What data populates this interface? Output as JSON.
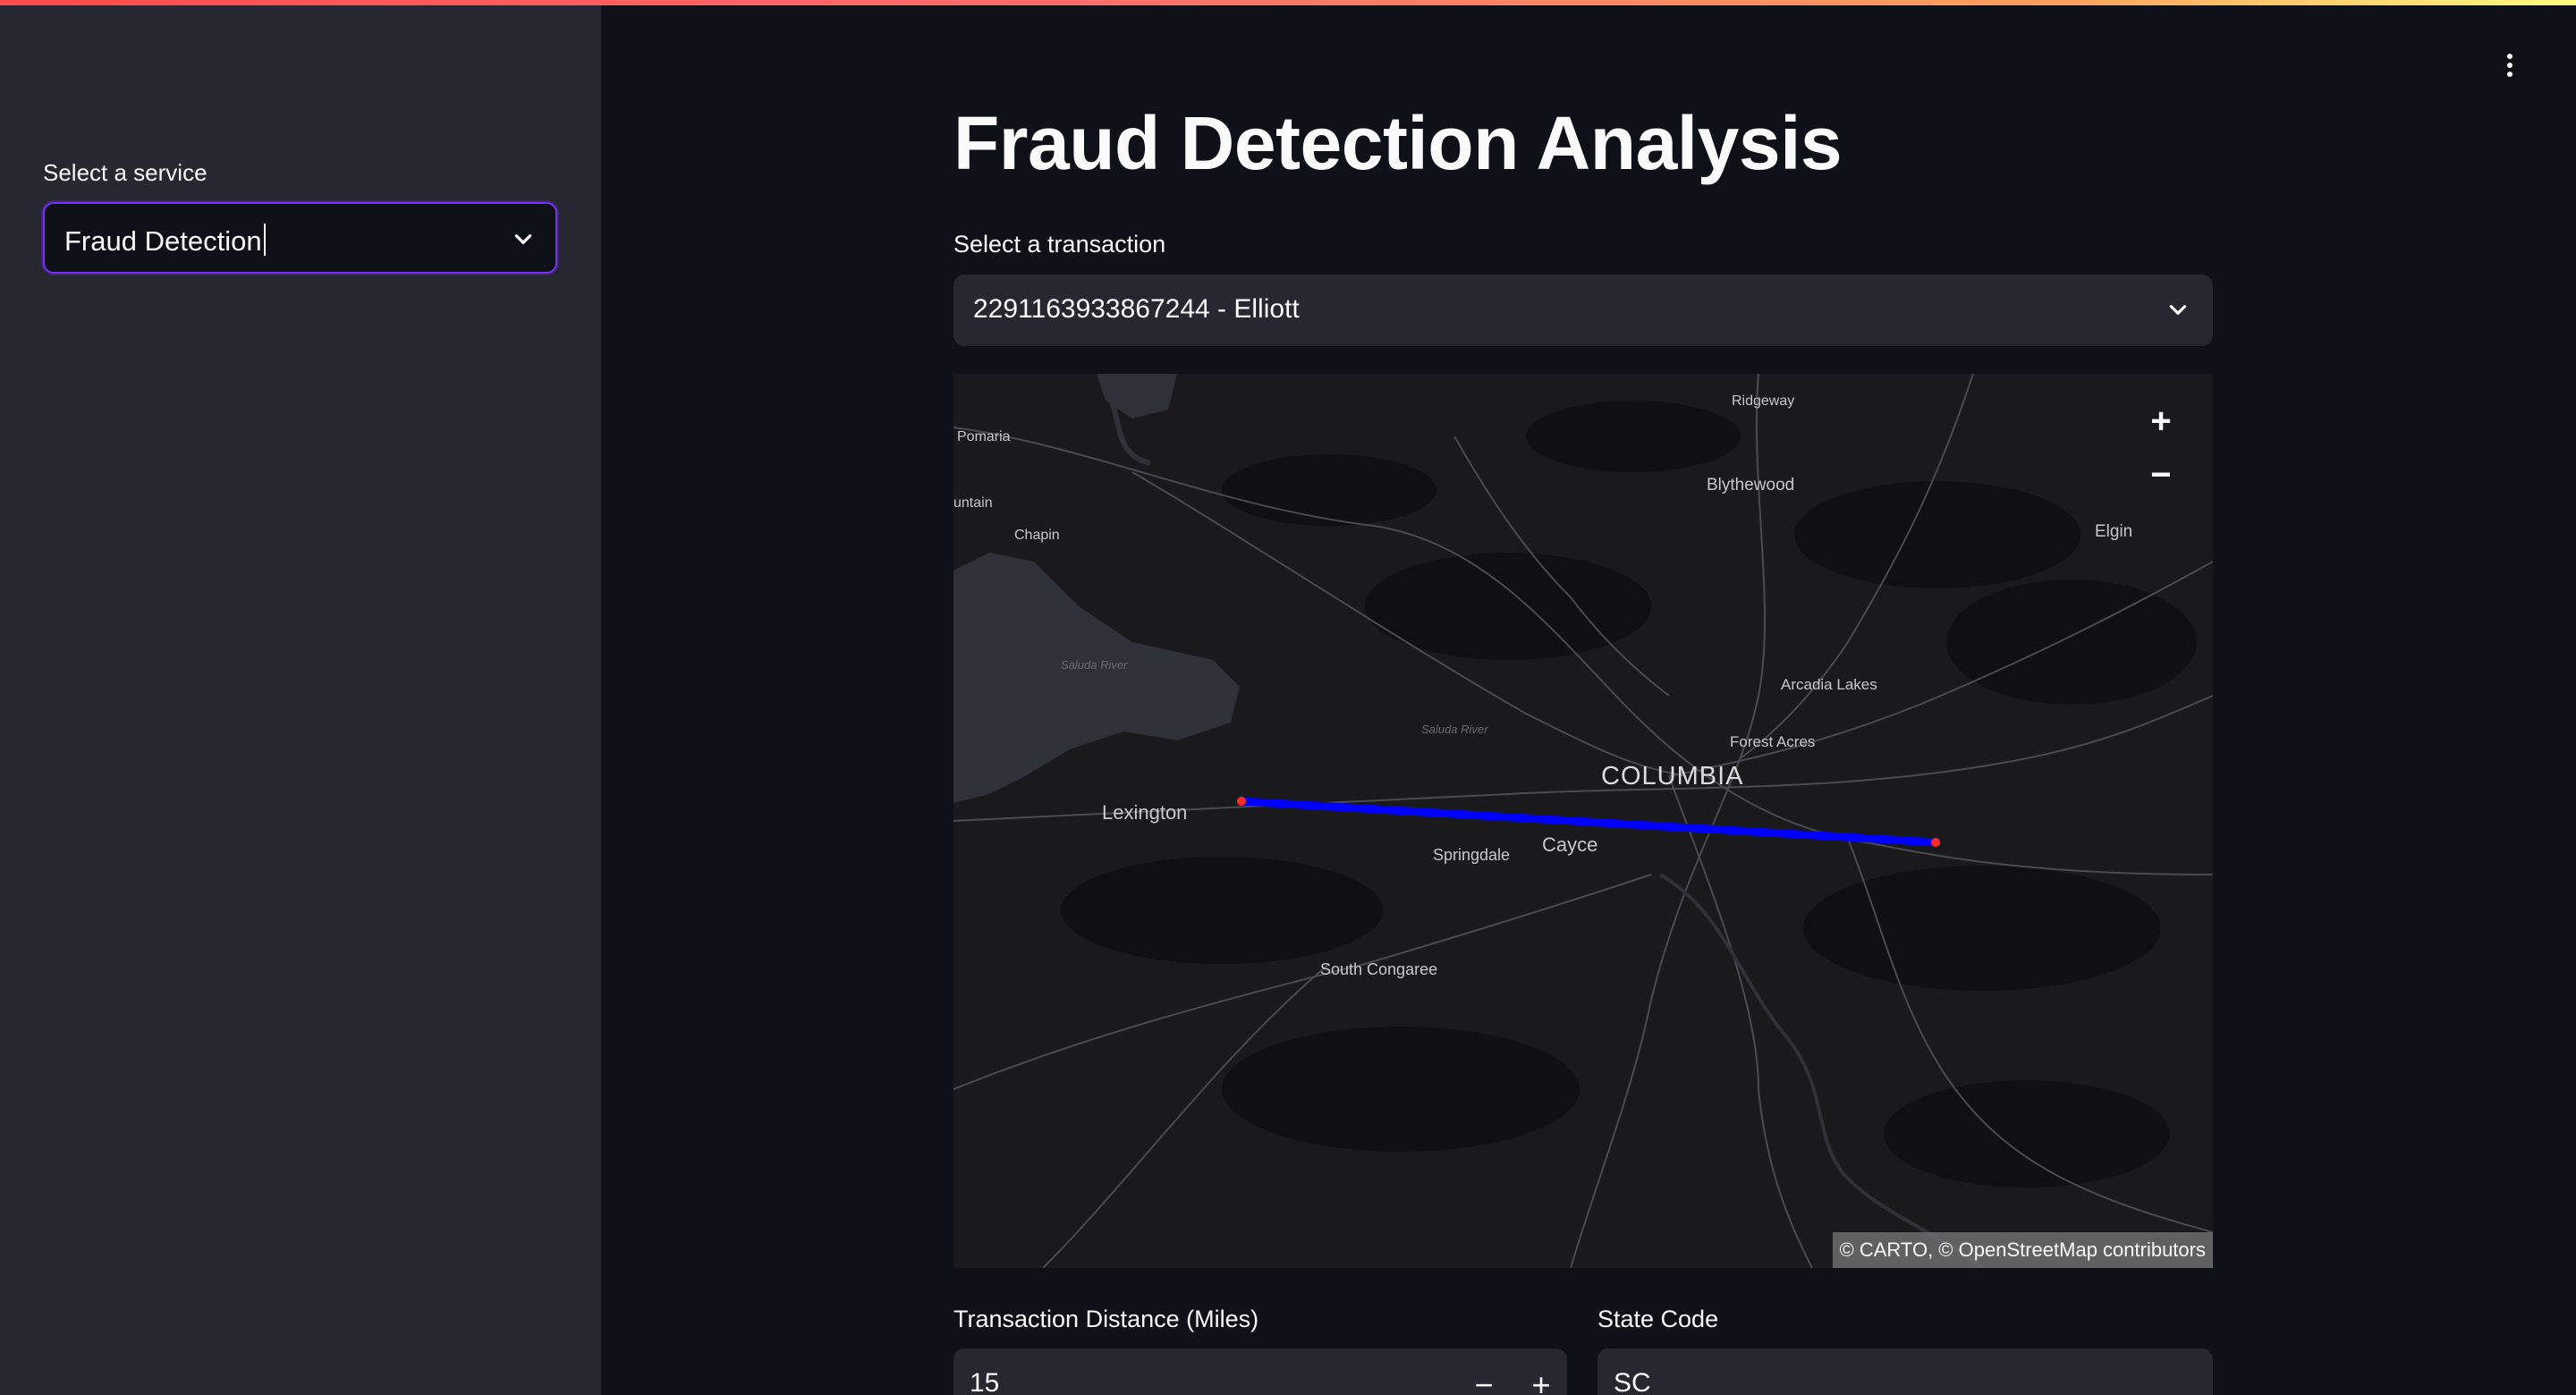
{
  "sidebar": {
    "service_label": "Select a service",
    "service_value": "Fraud Detection"
  },
  "main": {
    "title": "Fraud Detection Analysis",
    "transaction_label": "Select a transaction",
    "transaction_value": "2291163933867244 - Elliott",
    "fields": {
      "distance_label": "Transaction Distance (Miles)",
      "distance_value": "15",
      "state_label": "State Code",
      "state_value": "SC"
    }
  },
  "map": {
    "zoom_in": "+",
    "zoom_out": "−",
    "attribution": "© CARTO, © OpenStreetMap contributors",
    "route_color": "#0000ff",
    "endpoint_color": "#ff2b2b",
    "labels": {
      "ridgeway": "Ridgeway",
      "pomaria": "Pomaria",
      "blythewood": "Blythewood",
      "mountain": "untain",
      "chapin": "Chapin",
      "elgin": "Elgin",
      "saluda_river": "Saluda River",
      "arcadia_lakes": "Arcadia Lakes",
      "forest_acres": "Forest Acres",
      "saluda_river2": "Saluda River",
      "columbia": "COLUMBIA",
      "lexington": "Lexington",
      "cayce": "Cayce",
      "springdale": "Springdale",
      "south_congaree": "South Congaree"
    }
  },
  "icons": {
    "chevron": "chevron-down-icon",
    "kebab": "kebab-menu-icon"
  }
}
